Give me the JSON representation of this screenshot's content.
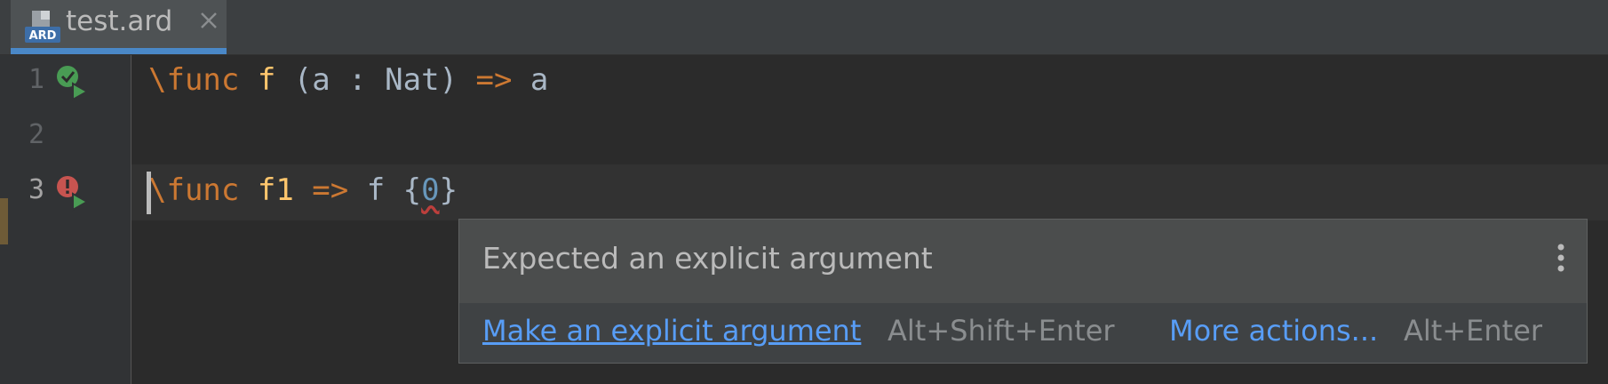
{
  "tab": {
    "title": "test.ard",
    "file_icon_label": "ARD",
    "close_icon": "close-icon",
    "accent": "#4a88c7"
  },
  "gutter": {
    "line_numbers": [
      "1",
      "2",
      "3"
    ],
    "run_icons": [
      "run-ok-icon",
      "run-error-icon"
    ]
  },
  "code": {
    "line1": {
      "kw": "\\func",
      "name": "f",
      "params": " (a : Nat) ",
      "arrow": "=>",
      "body": " a"
    },
    "line3": {
      "kw": "\\func",
      "name": "f1",
      "arrow": "=>",
      "call": " f {",
      "arg": "0",
      "close": "}"
    }
  },
  "popup": {
    "message": "Expected an explicit argument",
    "more_icon": "more-vertical-icon",
    "primary_action": "Make an explicit argument",
    "primary_shortcut": "Alt+Shift+Enter",
    "secondary_action": "More actions...",
    "secondary_shortcut": "Alt+Enter"
  },
  "colors": {
    "background": "#2b2b2b",
    "keyword": "#cc7832",
    "function": "#ffc66d",
    "number": "#6897bb",
    "link": "#589df6",
    "error": "#c75450",
    "success": "#499c54"
  }
}
